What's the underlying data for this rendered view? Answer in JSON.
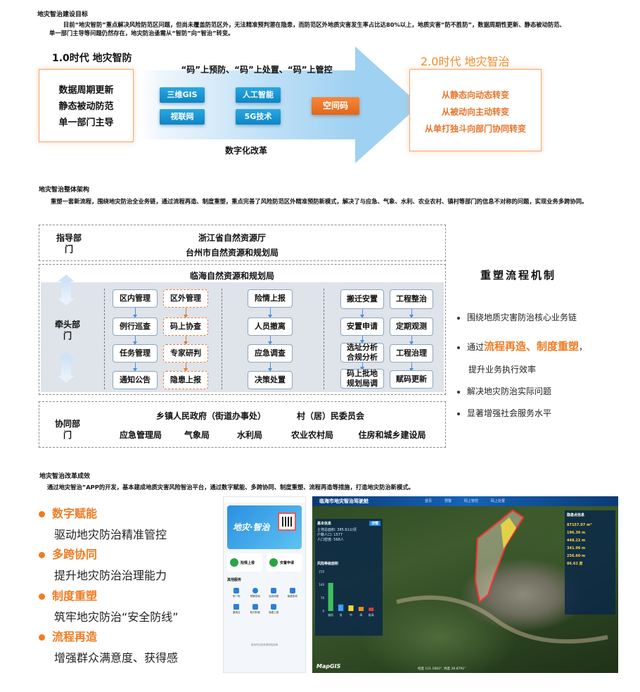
{
  "s1": {
    "title": "地灾智治建设目标",
    "para": "目前“地灾智防”重点解决风险防范区问题，但尚未覆盖防范区外，无法精准预判潜在隐患，而防范区外地质灾害发生率占比达80%以上，地质灾害“防不胜防”，数据周期性更新、静态被动防范、单一部门主导等问题仍然存在，地灾防治亟需从“智防”向“智治”转变。",
    "left_title": "1.0时代 地灾智防",
    "left_items": [
      "数据周期更新",
      "静态被动防范",
      "单一部门主导"
    ],
    "code_title": "“码”上预防、“码”上处置、“码”上管控",
    "chips": [
      "三维GIS",
      "人工智能",
      "视联网",
      "5G技术"
    ],
    "center_chip": "空间码",
    "digital": "数字化改革",
    "right_title": "2.0时代  地灾智治",
    "right_items": [
      "从静态向动态转变",
      "从被动向主动转变",
      "从单打独斗向部门协同转变"
    ]
  },
  "s2": {
    "title": "地灾智治整体架构",
    "para": "重塑一套新流程，围绕地灾防治全业务链，通过流程再造、制度重塑，重点完善了风险防范区外精准预防新模式，解决了与应急、气象、水利、农业农村、镇村等部门的信息不对称的问题，实现业务多跨协同。",
    "guide_label": "指导部门",
    "guide_orgs": [
      "浙江省自然资源厅",
      "台州市自然资源和规划局"
    ],
    "lead_title": "临海自然资源和规划局",
    "lead_label": "牵头部门",
    "boxes": {
      "a1": "区内管理",
      "a2": "区外管理",
      "b1": "例行巡查",
      "b2": "码上协查",
      "c1": "任务管理",
      "c2": "专家研判",
      "d1": "通知公告",
      "d2": "隐患上报",
      "m1": "险情上报",
      "m2": "人员撤离",
      "m3": "应急调查",
      "m4": "决策处置",
      "r1": "搬迁安置",
      "r2": "工程整治",
      "r3": "安置申请",
      "r4": "定期观测",
      "r5": "选址分析合规分析",
      "r6": "工程治理",
      "r7": "码上批地规划局调",
      "r8": "赋码更新"
    },
    "coop_label": "协同部门",
    "coop_row1": [
      "乡镇人民政府（街道办事处）",
      "村（居）民委员会"
    ],
    "coop_row2": [
      "应急管理局",
      "气象局",
      "水利局",
      "农业农村局",
      "住房和城乡建设局"
    ],
    "side_title": "重塑流程机制",
    "bullets": {
      "b1": "围绕地质灾害防治核心业务链",
      "b2_pre": "通过",
      "b2_hl": "流程再造、制度重塑",
      "b2_post": "，",
      "b2_line2": "提升业务执行效率",
      "b3": "解决地灾防治实际问题",
      "b4": "显著增强社会服务水平"
    }
  },
  "s3": {
    "title": "地灾智治改革成效",
    "para": "通过地灾智治”APP的开发，基本建成地质灾害风险智治平台，通过数字赋能、多跨协同、制度重塑、流程再造等措施，打造地灾防治新模式。",
    "items": [
      {
        "head": "数字赋能",
        "sub": "驱动地灾防治精准管控"
      },
      {
        "head": "多跨协同",
        "sub": "提升地灾防治治理能力"
      },
      {
        "head": "制度重塑",
        "sub": "筑牢地灾防治“安全防线”"
      },
      {
        "head": "流程再造",
        "sub": "增强群众满意度、获得感"
      }
    ],
    "phone": {
      "banner": "地灾·智治",
      "btn1": "险情上报",
      "btn2": "安置申请",
      "section": "其他服务",
      "icons": [
        "码一码",
        "预警查询",
        "巡查填报",
        "隐患查询",
        "避难点",
        "知识科普",
        "隐患上报"
      ],
      "footer": "临海市自然资源和规划局"
    },
    "map": {
      "title": "临海市地灾智治驾驶舱",
      "tabs": [
        "首页",
        "预警",
        "码上管控",
        "码上处置"
      ],
      "left_head": "基本信息",
      "left_btn": "详情",
      "left_lines": [
        "土地总面积: 385.61公顷",
        "户籍人口: 1577",
        "人口密度: 568人"
      ],
      "left_head2": "风险等级面积",
      "chart_labels": [
        "极低",
        "低",
        "中",
        "高",
        "极高"
      ],
      "right_head": "隐患点信息",
      "right_values": [
        "87157.07 m²",
        "196.36 m",
        "448.22 m",
        "341.96 m",
        "256.60 m",
        "86.62 度"
      ],
      "logo": "MapGIS",
      "coords": "经度 121.1683°, 纬度 28.8791°"
    }
  },
  "chart_data": {
    "type": "bar",
    "categories": [
      "极低",
      "低",
      "中",
      "高",
      "极高"
    ],
    "values": [
      150,
      35,
      30,
      22,
      18
    ],
    "ylim": [
      0,
      210
    ],
    "colors": [
      "#3fbf5f",
      "#3aa0ff",
      "#f5d33a",
      "#f08a2a",
      "#e33a3a"
    ]
  }
}
